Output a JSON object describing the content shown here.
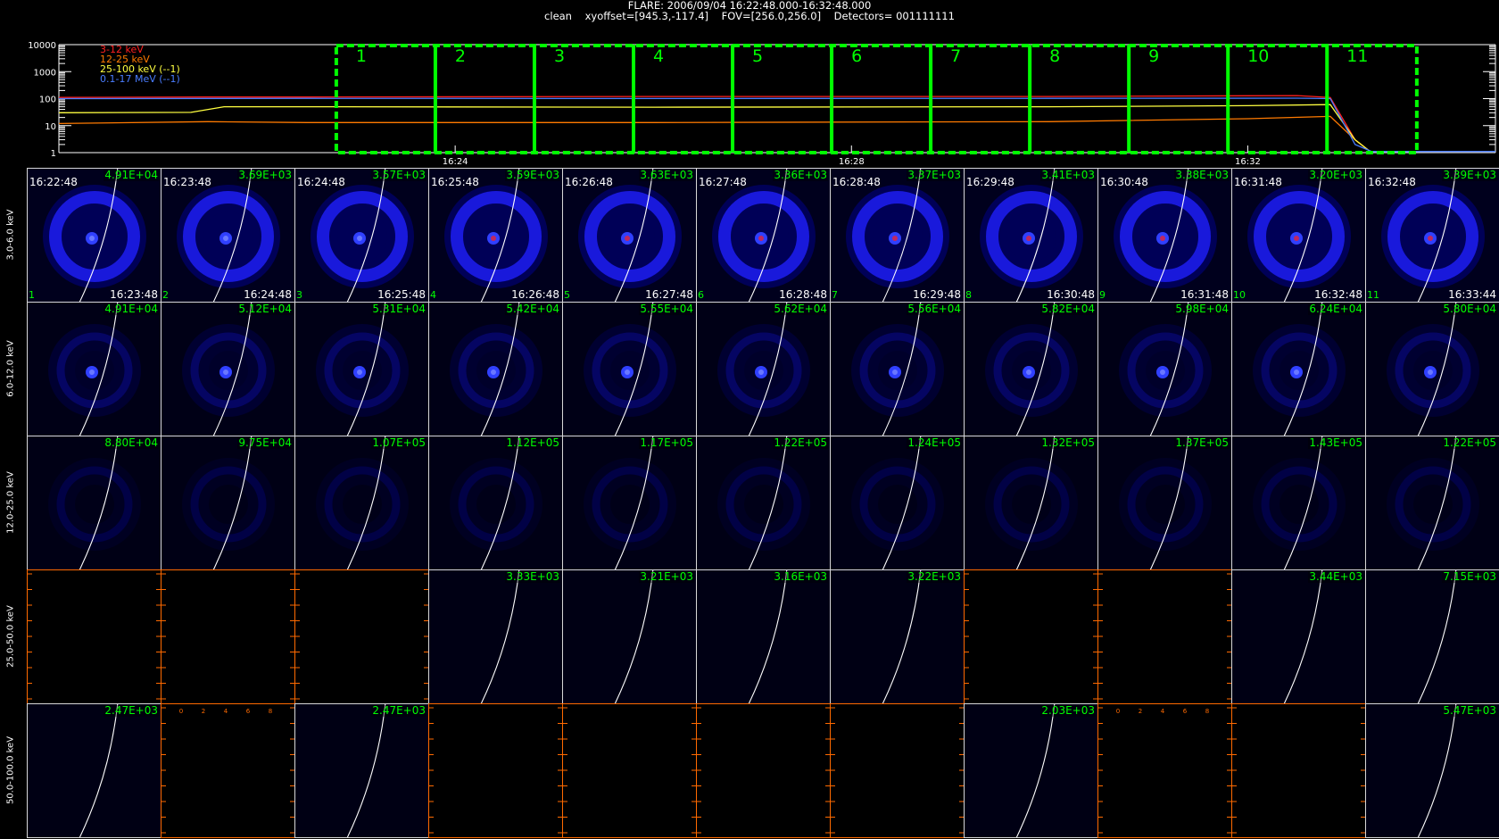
{
  "header": {
    "line1": "FLARE: 2006/09/04 16:22:48.000-16:32:48.000",
    "line2": "clean    xyoffset=[945.3,-117.4]    FOV=[256.0,256.0]    Detectors= 001111111"
  },
  "chart_data": [
    {
      "type": "line",
      "yscale": "log",
      "ylim": [
        1,
        10000
      ],
      "ytick_labels": [
        "10000",
        "1000",
        "100",
        "10",
        "1"
      ],
      "xtick_labels": [
        "16:24",
        "16:28",
        "16:32"
      ],
      "x_range": [
        "16:20:00",
        "16:34:30"
      ],
      "series": [
        {
          "name": "3-12 keV",
          "color": "#ff2020",
          "x": [
            "16:20:00",
            "16:21:30",
            "16:22:30",
            "16:26:00",
            "16:30:00",
            "16:32:30",
            "16:32:50",
            "16:33:05",
            "16:33:15"
          ],
          "values": [
            110,
            115,
            115,
            120,
            120,
            130,
            110,
            3,
            1
          ]
        },
        {
          "name": "12-25 keV",
          "color": "#ff7a00",
          "x": [
            "16:20:00",
            "16:21:30",
            "16:22:30",
            "16:26:00",
            "16:30:00",
            "16:32:00",
            "16:32:50",
            "16:33:05",
            "16:33:15"
          ],
          "values": [
            12,
            14,
            13,
            13,
            14,
            18,
            22,
            3,
            1
          ]
        },
        {
          "name": "25-100 keV (--1)",
          "color": "#ffff40",
          "x": [
            "16:20:00",
            "16:21:20",
            "16:21:40",
            "16:22:30",
            "16:26:00",
            "16:30:00",
            "16:32:00",
            "16:32:50",
            "16:33:05",
            "16:33:15"
          ],
          "values": [
            30,
            31,
            50,
            50,
            48,
            50,
            55,
            60,
            3,
            1
          ]
        },
        {
          "name": "0.1-17 MeV (--1)",
          "color": "#4a7dff",
          "x": [
            "16:20:00",
            "16:22:30",
            "16:26:00",
            "16:30:00",
            "16:32:30",
            "16:32:50",
            "16:33:05",
            "16:33:15",
            "16:34:30"
          ],
          "values": [
            100,
            102,
            101,
            102,
            104,
            100,
            2,
            1.1,
            1.1
          ]
        }
      ],
      "intervals": [
        {
          "label": "1",
          "start": "16:22:48",
          "end": "16:23:48"
        },
        {
          "label": "2",
          "start": "16:23:48",
          "end": "16:24:48"
        },
        {
          "label": "3",
          "start": "16:24:48",
          "end": "16:25:48"
        },
        {
          "label": "4",
          "start": "16:25:48",
          "end": "16:26:48"
        },
        {
          "label": "5",
          "start": "16:26:48",
          "end": "16:27:48"
        },
        {
          "label": "6",
          "start": "16:27:48",
          "end": "16:28:48"
        },
        {
          "label": "7",
          "start": "16:28:48",
          "end": "16:29:48"
        },
        {
          "label": "8",
          "start": "16:29:48",
          "end": "16:30:48"
        },
        {
          "label": "9",
          "start": "16:30:48",
          "end": "16:31:48"
        },
        {
          "label": "10",
          "start": "16:31:48",
          "end": "16:32:48"
        },
        {
          "label": "11",
          "start": "16:32:48",
          "end": "16:33:44"
        }
      ],
      "interval_color": "#00ff00"
    },
    {
      "type": "heatmap",
      "columns": 11,
      "energy_bands": [
        "3.0-6.0 keV",
        "6.0-12.0 keV",
        "12.0-25.0 keV",
        "25.0-50.0 keV",
        "50.0-100.0 keV"
      ],
      "start_times": [
        "16:22:48",
        "16:23:48",
        "16:24:48",
        "16:25:48",
        "16:26:48",
        "16:27:48",
        "16:28:48",
        "16:29:48",
        "16:30:48",
        "16:31:48",
        "16:32:48"
      ],
      "end_times": [
        "16:23:48",
        "16:24:48",
        "16:25:48",
        "16:26:48",
        "16:27:48",
        "16:28:48",
        "16:29:48",
        "16:30:48",
        "16:31:48",
        "16:32:48",
        "16:33:44"
      ],
      "interval_numbers": [
        "1",
        "2",
        "3",
        "4",
        "5",
        "6",
        "7",
        "8",
        "9",
        "10",
        "11"
      ],
      "peak_values": [
        [
          "4.91E+04",
          "3.69E+03",
          "3.57E+03",
          "3.59E+03",
          "3.63E+03",
          "3.36E+03",
          "3.37E+03",
          "3.41E+03",
          "3.38E+03",
          "3.20E+03",
          "3.39E+03"
        ],
        [
          "4.91E+04",
          "5.12E+04",
          "5.31E+04",
          "5.42E+04",
          "5.55E+04",
          "5.62E+04",
          "5.56E+04",
          "5.82E+04",
          "5.98E+04",
          "6.24E+04",
          "5.80E+04"
        ],
        [
          "8.80E+04",
          "9.75E+04",
          "1.07E+05",
          "1.12E+05",
          "1.17E+05",
          "1.22E+05",
          "1.24E+05",
          "1.32E+05",
          "1.37E+05",
          "1.43E+05",
          "1.22E+05"
        ],
        [
          null,
          null,
          null,
          "3.33E+03",
          "3.21E+03",
          "3.16E+03",
          "3.22E+03",
          null,
          null,
          "3.44E+03",
          "7.15E+03"
        ],
        [
          "2.47E+03",
          null,
          "2.47E+03",
          null,
          null,
          null,
          null,
          "2.03E+03",
          null,
          null,
          "5.47E+03"
        ]
      ],
      "empty_axis_tick_labels": [
        "0",
        "2",
        "4",
        "6",
        "8"
      ],
      "empty_axis_color": "#ff6a00"
    }
  ]
}
